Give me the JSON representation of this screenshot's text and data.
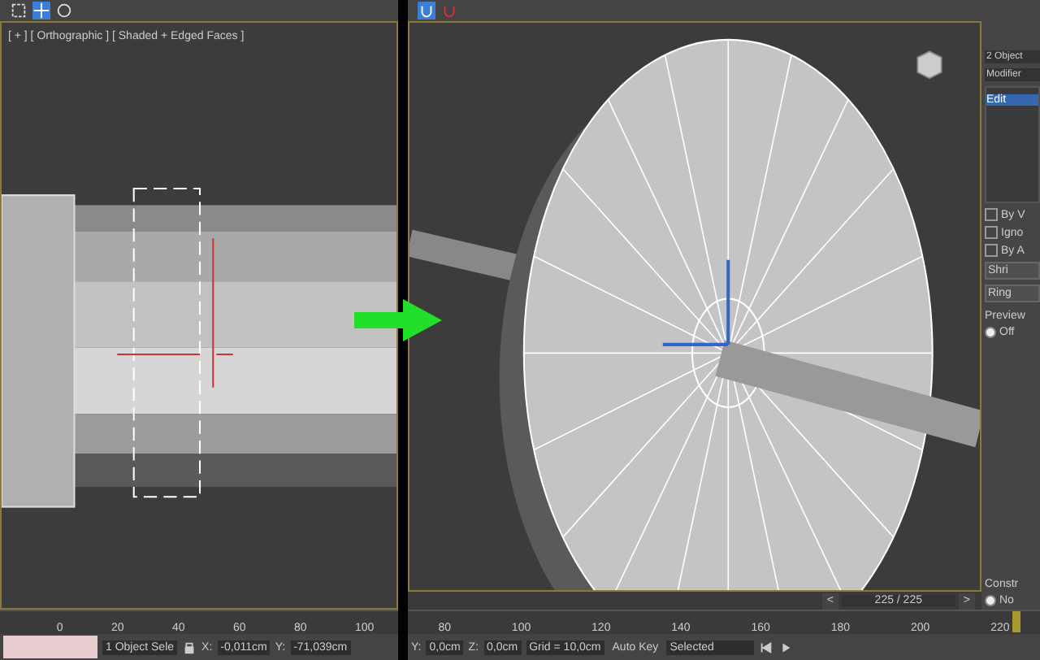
{
  "left": {
    "viewport_label": "[ + ] [ Orthographic ] [ Shaded + Edged Faces ]",
    "ruler_ticks": [
      "0",
      "20",
      "40",
      "60",
      "80",
      "100"
    ],
    "status": {
      "selection": "1 Object Sele",
      "x_label": "X:",
      "x": "-0,011cm",
      "y_label": "Y:",
      "y": "-71,039cm"
    }
  },
  "right": {
    "panel": {
      "selection": "2 Object",
      "modifier_list": "Modifier",
      "stack_item": "Edit",
      "checkboxes": [
        {
          "label": "By V",
          "checked": false
        },
        {
          "label": "Igno",
          "checked": false
        },
        {
          "label": "By A",
          "checked": false
        }
      ],
      "buttons": [
        "Shri",
        "Ring"
      ],
      "preview": {
        "title": "Preview",
        "option": "Off",
        "selected": true
      },
      "constraints": {
        "title": "Constr",
        "option": "No",
        "selected": true
      }
    },
    "frame_counter": "225 / 225",
    "prev": "<",
    "next": ">",
    "ruler_ticks": [
      "80",
      "100",
      "120",
      "140",
      "160",
      "180",
      "200",
      "220"
    ],
    "timeline": {
      "level": 0.97
    },
    "status": {
      "y_label": "Y:",
      "y": "0,0cm",
      "z_label": "Z:",
      "z": "0,0cm",
      "grid": "Grid = 10,0cm",
      "auto_key": "Auto Key",
      "key_filter": "Selected"
    }
  }
}
